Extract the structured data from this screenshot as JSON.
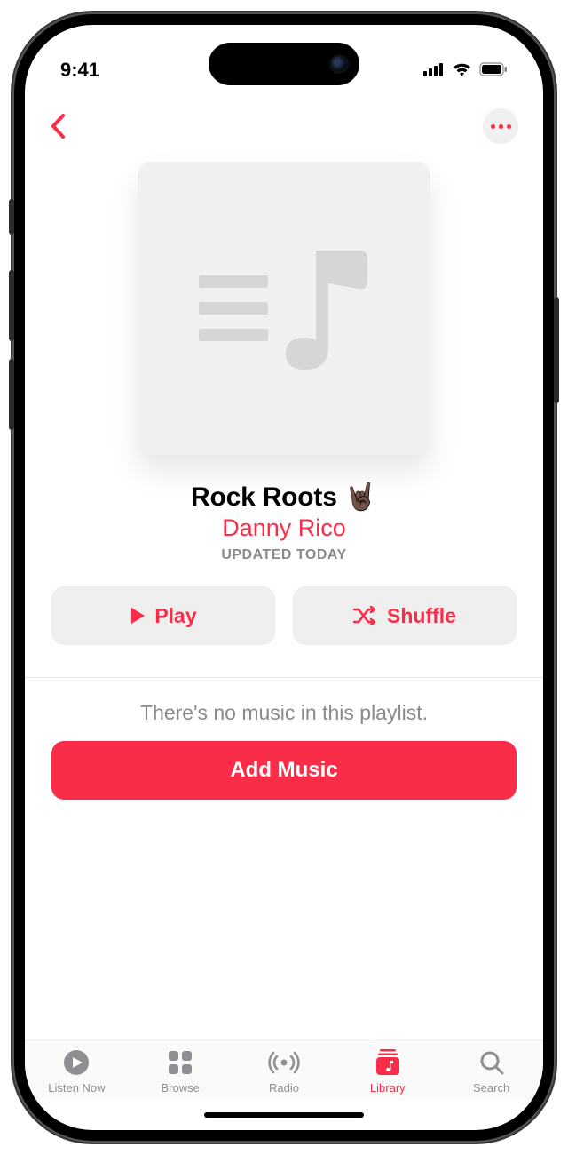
{
  "statusbar": {
    "time": "9:41"
  },
  "playlist": {
    "title": "Rock Roots 🤘🏿",
    "author": "Danny Rico",
    "updated": "UPDATED TODAY"
  },
  "actions": {
    "play": "Play",
    "shuffle": "Shuffle",
    "add_music": "Add Music"
  },
  "empty_message": "There's no music in this playlist.",
  "tabs": {
    "listen_now": "Listen Now",
    "browse": "Browse",
    "radio": "Radio",
    "library": "Library",
    "search": "Search"
  }
}
